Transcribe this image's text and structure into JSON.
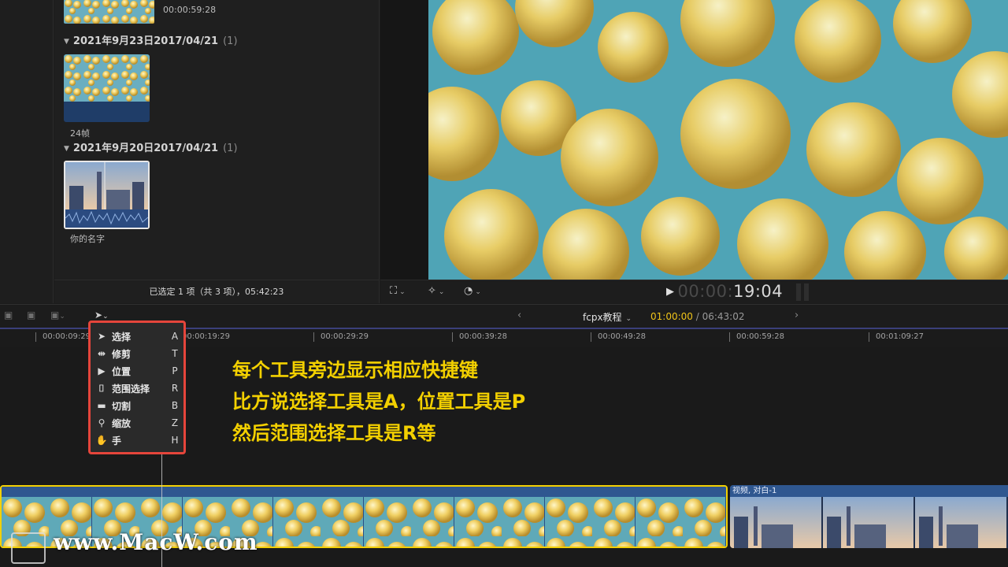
{
  "browser": {
    "top_clip_duration": "00:00:59:28",
    "groups": [
      {
        "title": "2021年9月23日2017/04/21",
        "count": "(1)",
        "clip_label": "24帧"
      },
      {
        "title": "2021年9月20日2017/04/21",
        "count": "(1)",
        "clip_label": "你的名字"
      }
    ],
    "status": "已选定 1 项（共 3 项），05:42:23"
  },
  "viewer": {
    "timecode_dim": "00:00:",
    "timecode": "19:04",
    "play_glyph": "▶"
  },
  "timeline": {
    "project_name": "fcpx教程",
    "current_time": "01:00:00",
    "total_time": "/ 06:43:02",
    "ruler_ticks": [
      "00:00:09:29",
      "00:00:19:29",
      "00:00:29:29",
      "00:00:39:28",
      "00:00:49:28",
      "00:00:59:28",
      "00:01:09:27"
    ],
    "second_clip_title": "视频, 对白-1"
  },
  "tools_menu": {
    "items": [
      {
        "label": "选择",
        "key": "A",
        "icon": "arrow-pointer-icon"
      },
      {
        "label": "修剪",
        "key": "T",
        "icon": "trim-icon"
      },
      {
        "label": "位置",
        "key": "P",
        "icon": "position-arrow-icon"
      },
      {
        "label": "范围选择",
        "key": "R",
        "icon": "range-select-icon"
      },
      {
        "label": "切割",
        "key": "B",
        "icon": "blade-icon"
      },
      {
        "label": "缩放",
        "key": "Z",
        "icon": "zoom-icon"
      },
      {
        "label": "手",
        "key": "H",
        "icon": "hand-icon"
      }
    ]
  },
  "annotation": {
    "lines": [
      "每个工具旁边显示相应快捷键",
      "比方说选择工具是A，位置工具是P",
      "然后范围选择工具是R等"
    ]
  },
  "watermark": "www.MacW.com",
  "colors": {
    "accent_yellow": "#f3d000",
    "highlight_red": "#e5453b",
    "clip_blue": "#2a4f86"
  }
}
